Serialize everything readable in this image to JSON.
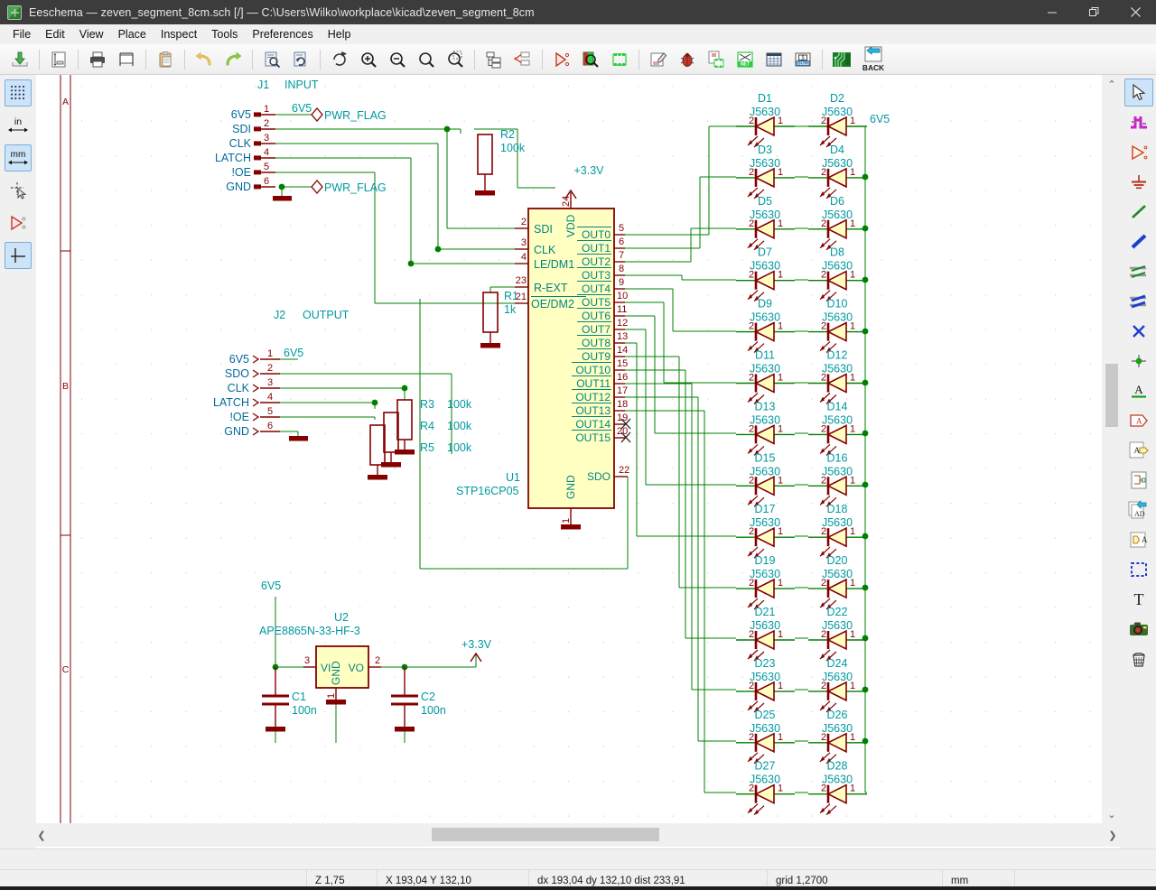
{
  "window": {
    "title": "Eeschema — zeven_segment_8cm.sch [/] — C:\\Users\\Wilko\\workplace\\kicad\\zeven_segment_8cm",
    "minimize": "—",
    "maximize": "❐",
    "close": "✕"
  },
  "menu": [
    "File",
    "Edit",
    "View",
    "Place",
    "Inspect",
    "Tools",
    "Preferences",
    "Help"
  ],
  "toolbar": {
    "items": [
      {
        "name": "save-sheet-button",
        "label": ""
      },
      {
        "name": "page-settings-button",
        "label": ""
      },
      {
        "name": "print-button",
        "label": ""
      },
      {
        "name": "plot-button",
        "label": ""
      },
      {
        "name": "paste-button",
        "label": ""
      },
      {
        "name": "undo-button",
        "label": ""
      },
      {
        "name": "redo-button",
        "label": ""
      },
      {
        "name": "find-button",
        "label": ""
      },
      {
        "name": "find-replace-button",
        "label": ""
      },
      {
        "name": "refresh-button",
        "label": ""
      },
      {
        "name": "zoom-in-button",
        "label": ""
      },
      {
        "name": "zoom-out-button",
        "label": ""
      },
      {
        "name": "zoom-fit-button",
        "label": ""
      },
      {
        "name": "zoom-area-button",
        "label": ""
      },
      {
        "name": "hierarchy-navigator-button",
        "label": ""
      },
      {
        "name": "leave-sheet-button",
        "label": ""
      },
      {
        "name": "annotate-button",
        "label": ""
      },
      {
        "name": "erc-button",
        "label": ""
      },
      {
        "name": "footprint-assign-button",
        "label": ""
      },
      {
        "name": "symbol-editor-button",
        "label": ""
      },
      {
        "name": "simulator-button",
        "label": ""
      },
      {
        "name": "netlist-button",
        "label": ""
      },
      {
        "name": "bom-export-button",
        "label": ""
      },
      {
        "name": "spreadsheet-button",
        "label": ""
      },
      {
        "name": "run-pcbnew-button",
        "label": ""
      },
      {
        "name": "back-import-button",
        "label": "BACK"
      }
    ],
    "back_label": "BACK"
  },
  "left_toolbar": {
    "items": [
      {
        "name": "toggle-grid-button",
        "label": "",
        "selected": true
      },
      {
        "name": "units-inches-button",
        "label": "in",
        "selected": false
      },
      {
        "name": "units-mm-button",
        "label": "mm",
        "selected": true
      },
      {
        "name": "toggle-cursor-button",
        "label": "",
        "selected": false
      },
      {
        "name": "toggle-hidden-pins-button",
        "label": "",
        "selected": false
      },
      {
        "name": "toggle-hv-wires-button",
        "label": "",
        "selected": true
      }
    ]
  },
  "right_toolbar": {
    "items": [
      {
        "name": "select-tool",
        "selected": true
      },
      {
        "name": "highlight-net-tool",
        "selected": false
      },
      {
        "name": "place-symbol-tool",
        "selected": false
      },
      {
        "name": "place-power-port-tool",
        "selected": false
      },
      {
        "name": "draw-wire-tool",
        "selected": false
      },
      {
        "name": "draw-bus-tool",
        "selected": false
      },
      {
        "name": "wire-to-bus-entry-tool",
        "selected": false
      },
      {
        "name": "bus-to-bus-entry-tool",
        "selected": false
      },
      {
        "name": "place-no-connect-tool",
        "selected": false
      },
      {
        "name": "place-junction-tool",
        "selected": false
      },
      {
        "name": "place-net-label-tool",
        "selected": false
      },
      {
        "name": "place-global-label-tool",
        "selected": false
      },
      {
        "name": "place-hierarchical-label-tool",
        "selected": false
      },
      {
        "name": "place-hierarchical-sheet-tool",
        "selected": false
      },
      {
        "name": "import-sheet-pin-tool",
        "selected": false
      },
      {
        "name": "place-sheet-pin-tool",
        "selected": false
      },
      {
        "name": "draw-rectangle-tool",
        "selected": false
      },
      {
        "name": "place-text-tool",
        "selected": false
      },
      {
        "name": "image-tool",
        "selected": false
      },
      {
        "name": "delete-tool",
        "selected": false
      }
    ]
  },
  "statusbar": {
    "zoom": "Z 1,75",
    "coords": "X 193,04  Y 132,10",
    "delta": "dx 193,04  dy 132,10  dist 233,91",
    "grid": "grid 1,2700",
    "units": "mm"
  },
  "schematic": {
    "page_row_labels": [
      "A",
      "B",
      "C"
    ],
    "connectors": [
      {
        "ref": "J1",
        "name": "INPUT",
        "pins": [
          {
            "num": "1",
            "label": "6V5"
          },
          {
            "num": "2",
            "label": "SDI"
          },
          {
            "num": "3",
            "label": "CLK"
          },
          {
            "num": "4",
            "label": "LATCH"
          },
          {
            "num": "5",
            "label": "!OE"
          },
          {
            "num": "6",
            "label": "GND"
          }
        ]
      },
      {
        "ref": "J2",
        "name": "OUTPUT",
        "pins": [
          {
            "num": "1",
            "label": "6V5"
          },
          {
            "num": "2",
            "label": "SDO"
          },
          {
            "num": "3",
            "label": "CLK"
          },
          {
            "num": "4",
            "label": "LATCH"
          },
          {
            "num": "5",
            "label": "!OE"
          },
          {
            "num": "6",
            "label": "GND"
          }
        ]
      }
    ],
    "power_flags": [
      "PWR_FLAG",
      "PWR_FLAG"
    ],
    "net_labels": [
      "6V5",
      "6V5",
      "6V5",
      "6V5",
      "+3.3V",
      "+3.3V"
    ],
    "resistors": [
      {
        "ref": "R1",
        "value": "1k"
      },
      {
        "ref": "R2",
        "value": "100k"
      },
      {
        "ref": "R3",
        "value": "100k"
      },
      {
        "ref": "R4",
        "value": "100k"
      },
      {
        "ref": "R5",
        "value": "100k"
      }
    ],
    "capacitors": [
      {
        "ref": "C1",
        "value": "100n"
      },
      {
        "ref": "C2",
        "value": "100n"
      }
    ],
    "ics": [
      {
        "ref": "U1",
        "value": "STP16CP05",
        "left_pins": [
          {
            "num": "2",
            "name": "SDI"
          },
          {
            "num": "3",
            "name": "CLK"
          },
          {
            "num": "4",
            "name": "LE/DM1"
          },
          {
            "num": "23",
            "name": "R-EXT"
          },
          {
            "num": "21",
            "name": "OE/DM2"
          }
        ],
        "right_pins": [
          {
            "num": "5",
            "name": "OUT0"
          },
          {
            "num": "6",
            "name": "OUT1"
          },
          {
            "num": "7",
            "name": "OUT2"
          },
          {
            "num": "8",
            "name": "OUT3"
          },
          {
            "num": "9",
            "name": "OUT4"
          },
          {
            "num": "10",
            "name": "OUT5"
          },
          {
            "num": "11",
            "name": "OUT6"
          },
          {
            "num": "12",
            "name": "OUT7"
          },
          {
            "num": "13",
            "name": "OUT8"
          },
          {
            "num": "14",
            "name": "OUT9"
          },
          {
            "num": "15",
            "name": "OUT10"
          },
          {
            "num": "16",
            "name": "OUT11"
          },
          {
            "num": "17",
            "name": "OUT12"
          },
          {
            "num": "18",
            "name": "OUT13"
          },
          {
            "num": "19",
            "name": "OUT14"
          },
          {
            "num": "20",
            "name": "OUT15"
          },
          {
            "num": "22",
            "name": "SDO"
          }
        ],
        "power_pins": [
          {
            "num": "24",
            "name": "VDD"
          },
          {
            "num": "1",
            "name": "GND"
          }
        ]
      },
      {
        "ref": "U2",
        "value": "APE8865N-33-HF-3",
        "left_pins": [
          {
            "num": "3",
            "name": "VI"
          }
        ],
        "right_pins": [
          {
            "num": "2",
            "name": "VO"
          }
        ],
        "power_pins": [
          {
            "num": "1",
            "name": "GND"
          }
        ]
      }
    ],
    "leds": [
      {
        "ref": "D1",
        "value": "J5630"
      },
      {
        "ref": "D2",
        "value": "J5630"
      },
      {
        "ref": "D3",
        "value": "J5630"
      },
      {
        "ref": "D4",
        "value": "J5630"
      },
      {
        "ref": "D5",
        "value": "J5630"
      },
      {
        "ref": "D6",
        "value": "J5630"
      },
      {
        "ref": "D7",
        "value": "J5630"
      },
      {
        "ref": "D8",
        "value": "J5630"
      },
      {
        "ref": "D9",
        "value": "J5630"
      },
      {
        "ref": "D10",
        "value": "J5630"
      },
      {
        "ref": "D11",
        "value": "J5630"
      },
      {
        "ref": "D12",
        "value": "J5630"
      },
      {
        "ref": "D13",
        "value": "J5630"
      },
      {
        "ref": "D14",
        "value": "J5630"
      },
      {
        "ref": "D15",
        "value": "J5630"
      },
      {
        "ref": "D16",
        "value": "J5630"
      },
      {
        "ref": "D17",
        "value": "J5630"
      },
      {
        "ref": "D18",
        "value": "J5630"
      },
      {
        "ref": "D19",
        "value": "J5630"
      },
      {
        "ref": "D20",
        "value": "J5630"
      },
      {
        "ref": "D21",
        "value": "J5630"
      },
      {
        "ref": "D22",
        "value": "J5630"
      },
      {
        "ref": "D23",
        "value": "J5630"
      },
      {
        "ref": "D24",
        "value": "J5630"
      },
      {
        "ref": "D25",
        "value": "J5630"
      },
      {
        "ref": "D26",
        "value": "J5630"
      },
      {
        "ref": "D27",
        "value": "J5630"
      },
      {
        "ref": "D28",
        "value": "J5630"
      }
    ],
    "led_pin_numbers": {
      "anode": "2",
      "cathode": "1"
    },
    "colors": {
      "wire": "#008000",
      "component_outline": "#840000",
      "component_fill": "#ffffc2",
      "label_text": "#0099a0",
      "pin_number": "#840000",
      "pin_name": "#008484",
      "page_border": "#840000",
      "background": "#ffffff"
    }
  }
}
